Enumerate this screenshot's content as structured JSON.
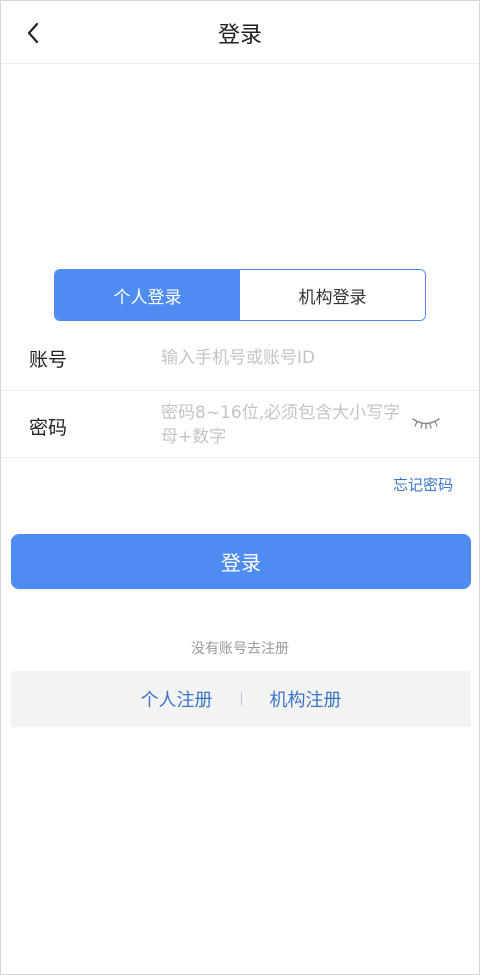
{
  "header": {
    "title": "登录"
  },
  "tabs": [
    {
      "label": "个人登录",
      "active": true
    },
    {
      "label": "机构登录",
      "active": false
    }
  ],
  "account": {
    "label": "账号",
    "placeholder": "输入手机号或账号ID",
    "value": ""
  },
  "password": {
    "label": "密码",
    "placeholder": "密码8~16位,必须包含大小写字母+数字",
    "value": ""
  },
  "forgot_label": "忘记密码",
  "login_button": "登录",
  "register": {
    "hint": "没有账号去注册",
    "personal": "个人注册",
    "institution": "机构注册"
  },
  "colors": {
    "accent": "#4e8cf2",
    "link": "#3a74c9"
  }
}
